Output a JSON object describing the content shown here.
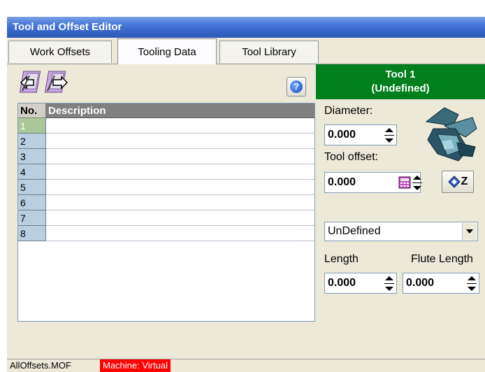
{
  "window": {
    "title": "Tool and Offset Editor"
  },
  "tabs": [
    {
      "label": "Work Offsets"
    },
    {
      "label": "Tooling Data"
    },
    {
      "label": "Tool Library"
    }
  ],
  "toolbar": {
    "import_icon": "import-arrow-icon",
    "export_icon": "export-arrow-icon",
    "help_icon": "help-icon",
    "help_glyph": "?"
  },
  "table": {
    "headers": {
      "no": "No.",
      "description": "Description"
    },
    "rows": [
      {
        "no": "1",
        "description": ""
      },
      {
        "no": "2",
        "description": ""
      },
      {
        "no": "3",
        "description": ""
      },
      {
        "no": "4",
        "description": ""
      },
      {
        "no": "5",
        "description": ""
      },
      {
        "no": "6",
        "description": ""
      },
      {
        "no": "7",
        "description": ""
      },
      {
        "no": "8",
        "description": ""
      }
    ],
    "selected_row": "1"
  },
  "tool": {
    "title": "Tool 1",
    "subtitle": "(Undefined)",
    "diameter_label": "Diameter:",
    "diameter_value": "0.000",
    "tool_offset_label": "Tool offset:",
    "tool_offset_value": "0.000",
    "type_value": "UnDefined",
    "length_label": "Length",
    "length_value": "0.000",
    "flute_length_label": "Flute Length",
    "flute_length_value": "0.000",
    "touch_z_label": "Z"
  },
  "status": {
    "file": "AllOffsets.MOF",
    "machine": "Machine: Virtual"
  },
  "colors": {
    "title_bar": "#3764c8",
    "tool_header": "#00801c",
    "machine_status": "#ff0000",
    "row_number": "#b7cfe0",
    "selected_row_number": "#a8c89a"
  }
}
